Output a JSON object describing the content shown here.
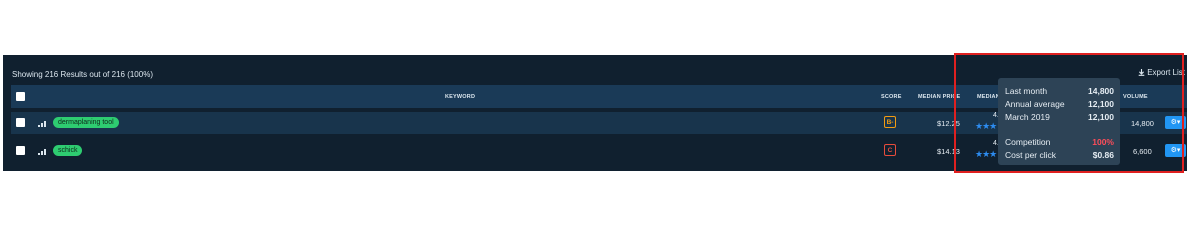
{
  "summary_text": "Showing 216 Results out of 216 (100%)",
  "export_label": "Export List",
  "columns": {
    "keyword": "KEYWORD",
    "score": "SCORE",
    "median_price": "MEDIAN PRICE",
    "median_rating": "MEDIAN R",
    "volume": "VOLUME"
  },
  "rows": [
    {
      "keyword": "dermaplaning tool",
      "score": "B-",
      "score_color": "#f39c12",
      "median_price": "$12.25",
      "rating": "4.3",
      "volume": "14,800"
    },
    {
      "keyword": "schick",
      "score": "C",
      "score_color": "#e74c3c",
      "median_price": "$14.13",
      "rating": "4.4",
      "volume": "6,600"
    }
  ],
  "tooltip": {
    "last_month_label": "Last month",
    "last_month_value": "14,800",
    "annual_avg_label": "Annual average",
    "annual_avg_value": "12,100",
    "month_label": "March 2019",
    "month_value": "12,100",
    "competition_label": "Competition",
    "competition_value": "100%",
    "cpc_label": "Cost per click",
    "cpc_value": "$0.86"
  },
  "colors": {
    "panel_bg": "#10202f",
    "header_bg": "#1a3a57",
    "tag_green": "#2ecc71",
    "button_blue": "#2196f3",
    "competition_red": "#ff4d5a",
    "highlight_red": "#e02020"
  },
  "icons": [
    "download-icon",
    "bars-icon",
    "star-icon",
    "gear-icon",
    "caret-down-icon"
  ]
}
